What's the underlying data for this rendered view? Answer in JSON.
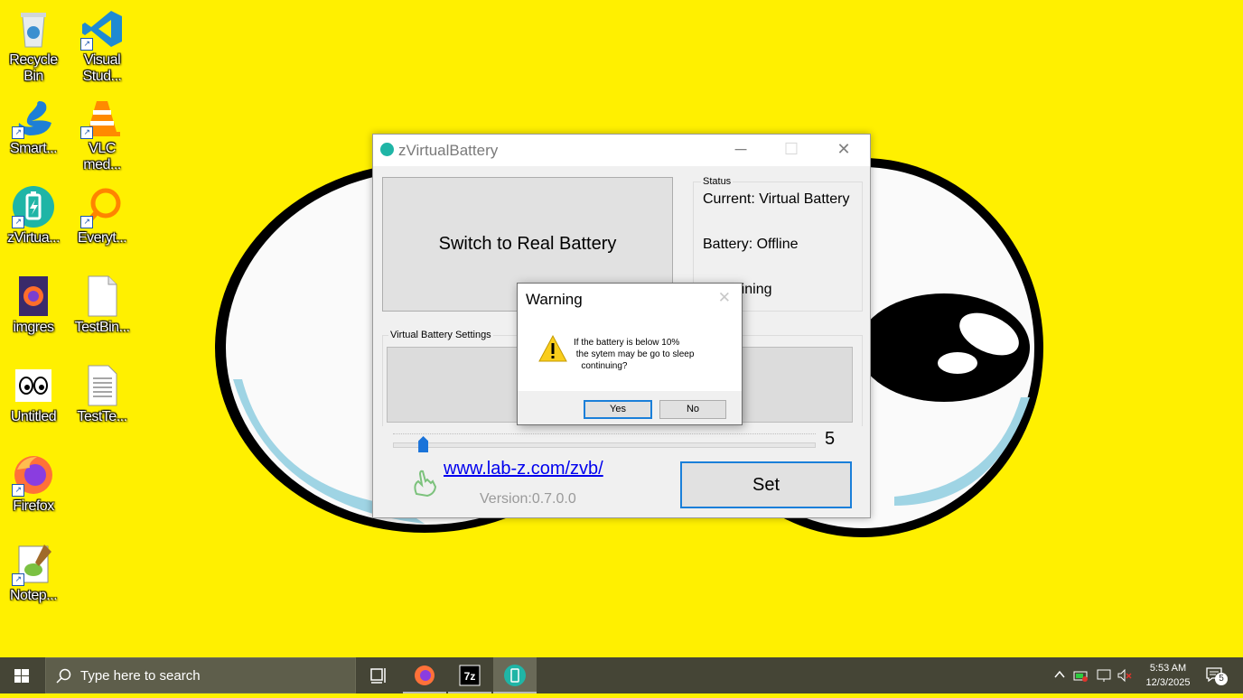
{
  "desktop": {
    "icons": [
      {
        "label": "Recycle\nBin",
        "icon": "recycle-bin-icon"
      },
      {
        "label": "Visual\nStud...",
        "icon": "vscode-icon"
      },
      {
        "label": "Smart...",
        "icon": "swan-icon"
      },
      {
        "label": "VLC\nmed...",
        "icon": "vlc-cone-icon"
      },
      {
        "label": "zVirtua...",
        "icon": "zvirtualbattery-icon"
      },
      {
        "label": "Everyt...",
        "icon": "everything-search-icon"
      },
      {
        "label": "imgres",
        "icon": "firefox-file-icon"
      },
      {
        "label": "TestBin...",
        "icon": "blank-file-icon"
      },
      {
        "label": "Untitled",
        "icon": "eyes-image-icon"
      },
      {
        "label": "TestTe...",
        "icon": "text-file-icon"
      },
      {
        "label": "Firefox",
        "icon": "firefox-icon"
      },
      {
        "label": "Notep...",
        "icon": "notepad-plus-icon"
      }
    ]
  },
  "window": {
    "title": "zVirtualBattery",
    "switch_label": "Switch to Real Battery",
    "status_legend": "Status",
    "status_lines": [
      "Current: Virtual Battery",
      "Battery: Offline",
      "Remaining"
    ],
    "settings_legend": "Virtual Battery Settings",
    "slider_value": "5",
    "slider_fraction": 0.06,
    "link_text": "www.lab-z.com/zvb/",
    "version": "Version:0.7.0.0",
    "set_label": "Set"
  },
  "dialog": {
    "title": "Warning",
    "message": "If the battery is below 10%\n the sytem may be go to sleep\n   continuing?",
    "yes_label": "Yes",
    "no_label": "No"
  },
  "taskbar": {
    "search_placeholder": "Type here to search",
    "time": "5:53 AM",
    "date": "12/3/2025",
    "notifications": "5"
  },
  "colors": {
    "wallpaper": "#fff000",
    "accent": "#1a7fd9"
  }
}
